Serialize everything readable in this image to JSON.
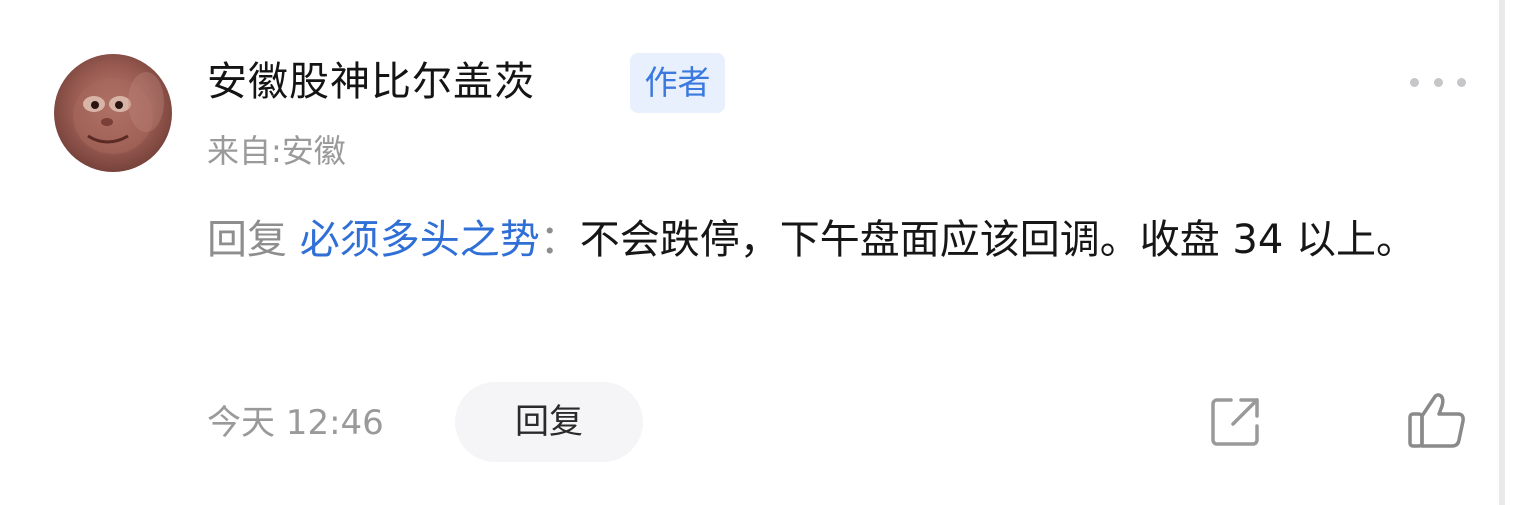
{
  "comment": {
    "user_name": "安徽股神比尔盖茨",
    "author_badge": "作者",
    "location": "来自:安徽",
    "reply_prefix": "回复",
    "reply_target": "必须多头之势",
    "reply_separator": "：",
    "body": "不会跌停，下午盘面应该回调。收盘 34 以上。",
    "time": "今天 12:46",
    "reply_button_label": "回复",
    "more_icon": "more-horizontal-icon",
    "share_icon": "share-icon",
    "like_icon": "thumbs-up-icon"
  },
  "colors": {
    "accent": "#2f6fd6",
    "badge_bg": "#e8f0fd",
    "muted_text": "#9a9a9a",
    "primary_text": "#161616"
  }
}
